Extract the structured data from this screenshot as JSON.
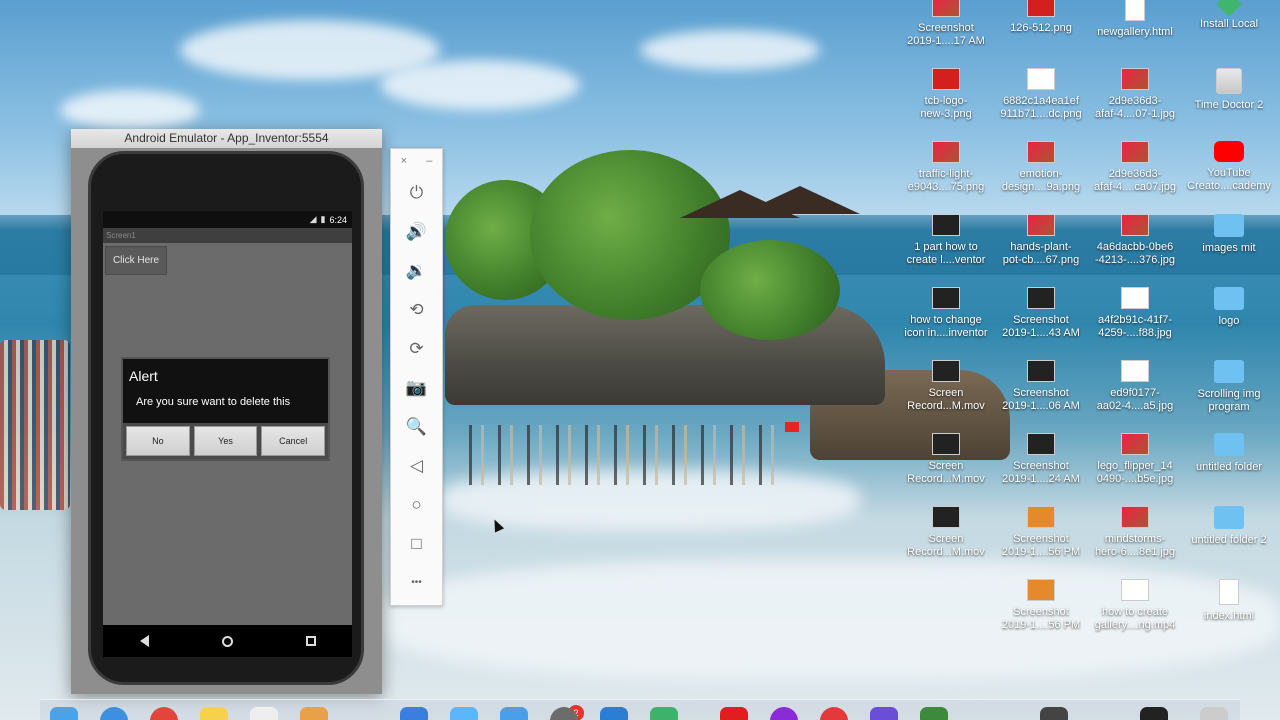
{
  "emulator": {
    "window_title": "Android Emulator - App_Inventor:5554",
    "status_time": "6:24",
    "app_screen_title": "Screen1",
    "click_button_label": "Click Here"
  },
  "dialog": {
    "title": "Alert",
    "message": "Are you sure want to delete this",
    "buttons": [
      "No",
      "Yes",
      "Cancel"
    ]
  },
  "side_toolbar": {
    "close_glyph": "×",
    "minimize_glyph": "–",
    "items": [
      {
        "icon": "power-icon",
        "glyph": "⏻"
      },
      {
        "icon": "volume-up-icon",
        "glyph": "🔊"
      },
      {
        "icon": "volume-down-icon",
        "glyph": "🔉"
      },
      {
        "icon": "rotate-left-icon",
        "glyph": "⟲"
      },
      {
        "icon": "rotate-right-icon",
        "glyph": "⟳"
      },
      {
        "icon": "camera-icon",
        "glyph": "📷"
      },
      {
        "icon": "zoom-icon",
        "glyph": "🔍"
      },
      {
        "icon": "back-icon",
        "glyph": "◁"
      },
      {
        "icon": "home-icon",
        "glyph": "○"
      },
      {
        "icon": "overview-icon",
        "glyph": "□"
      },
      {
        "icon": "more-icon",
        "glyph": "•••"
      }
    ]
  },
  "desktop_icons": {
    "col1": [
      {
        "label": "Screenshot\n2019-1....17 AM",
        "type": "pic"
      },
      {
        "label": "tcb-logo-\nnew-3.png",
        "type": "red"
      },
      {
        "label": "traffic-light-\ne9043....75.png",
        "type": "pic"
      },
      {
        "label": "1 part how to\ncreate l....ventor",
        "type": "dark"
      },
      {
        "label": "how to change\nicon in....inventor",
        "type": "dark"
      },
      {
        "label": "Screen\nRecord...M.mov",
        "type": "dark"
      },
      {
        "label": "Screen\nRecord...M.mov",
        "type": "dark"
      },
      {
        "label": "Screen\nRecord...M.mov",
        "type": "dark"
      }
    ],
    "col2": [
      {
        "label": "126-512.png",
        "type": "red"
      },
      {
        "label": "6882c1a4ea1ef\n911b71....dc.png",
        "type": "plain"
      },
      {
        "label": "emotion-\ndesign....9a.png",
        "type": "pic"
      },
      {
        "label": "hands-plant-\npot-cb....67.png",
        "type": "pic"
      },
      {
        "label": "Screenshot\n2019-1....43 AM",
        "type": "dark"
      },
      {
        "label": "Screenshot\n2019-1....06 AM",
        "type": "dark"
      },
      {
        "label": "Screenshot\n2019-1....24 AM",
        "type": "dark"
      },
      {
        "label": "Screenshot\n2019-1....56 PM",
        "type": "orange"
      },
      {
        "label": "Screenshot\n2019-1....56 PM",
        "type": "orange"
      }
    ],
    "col3": [
      {
        "label": "newgallery.html",
        "type": "doc"
      },
      {
        "label": "2d9e36d3-\nafaf-4....07-1.jpg",
        "type": "pic"
      },
      {
        "label": "2d9e36d3-\nafaf-4....ca07.jpg",
        "type": "pic"
      },
      {
        "label": "4a6dacbb-0be6\n-4213-....376.jpg",
        "type": "pic"
      },
      {
        "label": "a4f2b91c-41f7-\n4259-....f88.jpg",
        "type": "plain"
      },
      {
        "label": "ed9f0177-\naa02-4....a5.jpg",
        "type": "plain"
      },
      {
        "label": "lego_flipper_14\n0490-....b5e.jpg",
        "type": "pic"
      },
      {
        "label": "mindstorms-\nhero-6....8e1.jpg",
        "type": "pic"
      },
      {
        "label": "how to create\ngallery....ng.mp4",
        "type": "plain"
      }
    ],
    "col4": [
      {
        "label": "Install Local",
        "type": "green"
      },
      {
        "label": "Time Doctor 2",
        "type": "drive"
      },
      {
        "label": "YouTube\nCreato....cademy",
        "type": "yt"
      },
      {
        "label": "images mit",
        "type": "folder"
      },
      {
        "label": "logo",
        "type": "folder"
      },
      {
        "label": "Scrolling img\nprogram",
        "type": "folder"
      },
      {
        "label": "untitled folder",
        "type": "folder"
      },
      {
        "label": "untitled folder 2",
        "type": "folder"
      },
      {
        "label": "index.html",
        "type": "doc"
      }
    ]
  },
  "dock": {
    "badge_count": "2"
  }
}
